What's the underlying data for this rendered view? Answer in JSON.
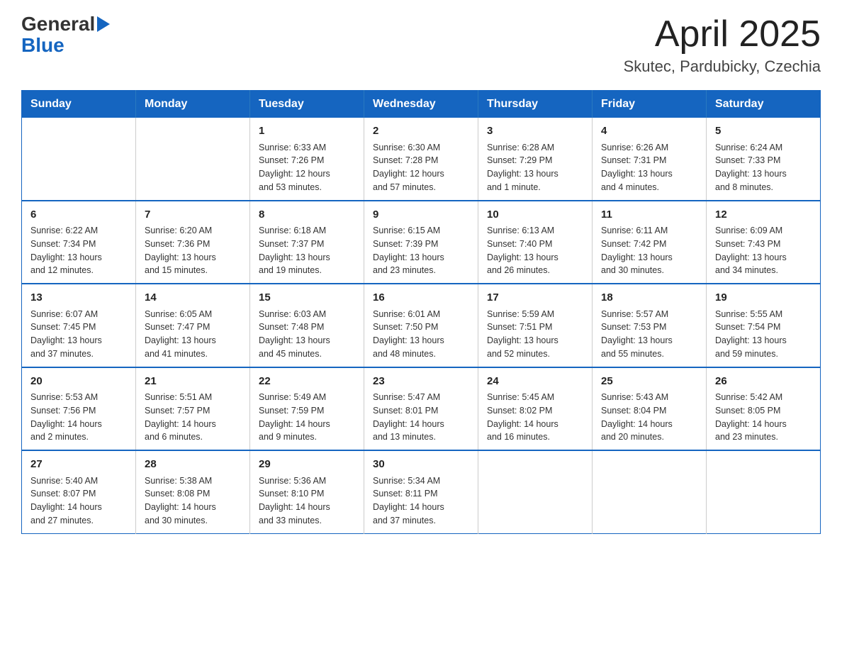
{
  "header": {
    "logo_general": "General",
    "logo_blue": "Blue",
    "main_title": "April 2025",
    "subtitle": "Skutec, Pardubicky, Czechia"
  },
  "calendar": {
    "days_of_week": [
      "Sunday",
      "Monday",
      "Tuesday",
      "Wednesday",
      "Thursday",
      "Friday",
      "Saturday"
    ],
    "weeks": [
      [
        {
          "day": "",
          "info": ""
        },
        {
          "day": "",
          "info": ""
        },
        {
          "day": "1",
          "info": "Sunrise: 6:33 AM\nSunset: 7:26 PM\nDaylight: 12 hours\nand 53 minutes."
        },
        {
          "day": "2",
          "info": "Sunrise: 6:30 AM\nSunset: 7:28 PM\nDaylight: 12 hours\nand 57 minutes."
        },
        {
          "day": "3",
          "info": "Sunrise: 6:28 AM\nSunset: 7:29 PM\nDaylight: 13 hours\nand 1 minute."
        },
        {
          "day": "4",
          "info": "Sunrise: 6:26 AM\nSunset: 7:31 PM\nDaylight: 13 hours\nand 4 minutes."
        },
        {
          "day": "5",
          "info": "Sunrise: 6:24 AM\nSunset: 7:33 PM\nDaylight: 13 hours\nand 8 minutes."
        }
      ],
      [
        {
          "day": "6",
          "info": "Sunrise: 6:22 AM\nSunset: 7:34 PM\nDaylight: 13 hours\nand 12 minutes."
        },
        {
          "day": "7",
          "info": "Sunrise: 6:20 AM\nSunset: 7:36 PM\nDaylight: 13 hours\nand 15 minutes."
        },
        {
          "day": "8",
          "info": "Sunrise: 6:18 AM\nSunset: 7:37 PM\nDaylight: 13 hours\nand 19 minutes."
        },
        {
          "day": "9",
          "info": "Sunrise: 6:15 AM\nSunset: 7:39 PM\nDaylight: 13 hours\nand 23 minutes."
        },
        {
          "day": "10",
          "info": "Sunrise: 6:13 AM\nSunset: 7:40 PM\nDaylight: 13 hours\nand 26 minutes."
        },
        {
          "day": "11",
          "info": "Sunrise: 6:11 AM\nSunset: 7:42 PM\nDaylight: 13 hours\nand 30 minutes."
        },
        {
          "day": "12",
          "info": "Sunrise: 6:09 AM\nSunset: 7:43 PM\nDaylight: 13 hours\nand 34 minutes."
        }
      ],
      [
        {
          "day": "13",
          "info": "Sunrise: 6:07 AM\nSunset: 7:45 PM\nDaylight: 13 hours\nand 37 minutes."
        },
        {
          "day": "14",
          "info": "Sunrise: 6:05 AM\nSunset: 7:47 PM\nDaylight: 13 hours\nand 41 minutes."
        },
        {
          "day": "15",
          "info": "Sunrise: 6:03 AM\nSunset: 7:48 PM\nDaylight: 13 hours\nand 45 minutes."
        },
        {
          "day": "16",
          "info": "Sunrise: 6:01 AM\nSunset: 7:50 PM\nDaylight: 13 hours\nand 48 minutes."
        },
        {
          "day": "17",
          "info": "Sunrise: 5:59 AM\nSunset: 7:51 PM\nDaylight: 13 hours\nand 52 minutes."
        },
        {
          "day": "18",
          "info": "Sunrise: 5:57 AM\nSunset: 7:53 PM\nDaylight: 13 hours\nand 55 minutes."
        },
        {
          "day": "19",
          "info": "Sunrise: 5:55 AM\nSunset: 7:54 PM\nDaylight: 13 hours\nand 59 minutes."
        }
      ],
      [
        {
          "day": "20",
          "info": "Sunrise: 5:53 AM\nSunset: 7:56 PM\nDaylight: 14 hours\nand 2 minutes."
        },
        {
          "day": "21",
          "info": "Sunrise: 5:51 AM\nSunset: 7:57 PM\nDaylight: 14 hours\nand 6 minutes."
        },
        {
          "day": "22",
          "info": "Sunrise: 5:49 AM\nSunset: 7:59 PM\nDaylight: 14 hours\nand 9 minutes."
        },
        {
          "day": "23",
          "info": "Sunrise: 5:47 AM\nSunset: 8:01 PM\nDaylight: 14 hours\nand 13 minutes."
        },
        {
          "day": "24",
          "info": "Sunrise: 5:45 AM\nSunset: 8:02 PM\nDaylight: 14 hours\nand 16 minutes."
        },
        {
          "day": "25",
          "info": "Sunrise: 5:43 AM\nSunset: 8:04 PM\nDaylight: 14 hours\nand 20 minutes."
        },
        {
          "day": "26",
          "info": "Sunrise: 5:42 AM\nSunset: 8:05 PM\nDaylight: 14 hours\nand 23 minutes."
        }
      ],
      [
        {
          "day": "27",
          "info": "Sunrise: 5:40 AM\nSunset: 8:07 PM\nDaylight: 14 hours\nand 27 minutes."
        },
        {
          "day": "28",
          "info": "Sunrise: 5:38 AM\nSunset: 8:08 PM\nDaylight: 14 hours\nand 30 minutes."
        },
        {
          "day": "29",
          "info": "Sunrise: 5:36 AM\nSunset: 8:10 PM\nDaylight: 14 hours\nand 33 minutes."
        },
        {
          "day": "30",
          "info": "Sunrise: 5:34 AM\nSunset: 8:11 PM\nDaylight: 14 hours\nand 37 minutes."
        },
        {
          "day": "",
          "info": ""
        },
        {
          "day": "",
          "info": ""
        },
        {
          "day": "",
          "info": ""
        }
      ]
    ]
  }
}
